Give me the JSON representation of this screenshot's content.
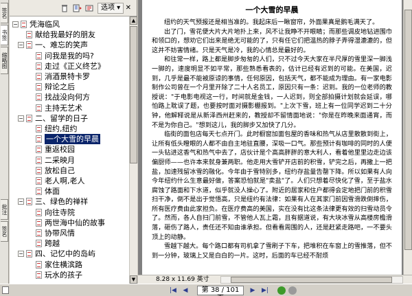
{
  "side_tabs": [
    "签名",
    "书签",
    "缩略图",
    "批注",
    "签名"
  ],
  "panel": {
    "options_label": "选项 ▾",
    "close_label": "✕",
    "bookmarks": [
      {
        "label": "凭海临风",
        "level": 0,
        "expanded": true,
        "selected": false
      },
      {
        "label": "献给我最好的朋友",
        "level": 1,
        "expanded": null,
        "selected": false
      },
      {
        "label": "一、难忘的笑声",
        "level": 1,
        "expanded": true,
        "selected": false
      },
      {
        "label": "问我是我的吗?",
        "level": 2,
        "expanded": null,
        "selected": false
      },
      {
        "label": "走过《正义终艺》",
        "level": 2,
        "expanded": null,
        "selected": false
      },
      {
        "label": "消酒景特卡罗",
        "level": 2,
        "expanded": null,
        "selected": false
      },
      {
        "label": "辩论之后",
        "level": 2,
        "expanded": null,
        "selected": false
      },
      {
        "label": "找战没向何方",
        "level": 2,
        "expanded": null,
        "selected": false
      },
      {
        "label": "主持无艺术",
        "level": 2,
        "expanded": null,
        "selected": false
      },
      {
        "label": "二、留学的日子",
        "level": 1,
        "expanded": true,
        "selected": false
      },
      {
        "label": "纽约,纽约",
        "level": 2,
        "expanded": null,
        "selected": false
      },
      {
        "label": "一个大雪的早晨",
        "level": 2,
        "expanded": null,
        "selected": true
      },
      {
        "label": "重返校园",
        "level": 2,
        "expanded": null,
        "selected": false
      },
      {
        "label": "二采映月",
        "level": 2,
        "expanded": null,
        "selected": false
      },
      {
        "label": "放松自己",
        "level": 2,
        "expanded": null,
        "selected": false
      },
      {
        "label": "老人啊,老人",
        "level": 2,
        "expanded": null,
        "selected": false
      },
      {
        "label": "体面",
        "level": 2,
        "expanded": null,
        "selected": false
      },
      {
        "label": "三、绿色的禅祥",
        "level": 1,
        "expanded": true,
        "selected": false
      },
      {
        "label": "向往寺院",
        "level": 2,
        "expanded": null,
        "selected": false
      },
      {
        "label": "两世海中仙的故事",
        "level": 2,
        "expanded": null,
        "selected": false
      },
      {
        "label": "协带风情",
        "level": 2,
        "expanded": null,
        "selected": false
      },
      {
        "label": "跨越",
        "level": 2,
        "expanded": null,
        "selected": false
      },
      {
        "label": "四、记忆中的岛屿",
        "level": 1,
        "expanded": true,
        "selected": false
      },
      {
        "label": "家住横滨路",
        "level": 2,
        "expanded": null,
        "selected": false
      },
      {
        "label": "玩水的孩子",
        "level": 2,
        "expanded": null,
        "selected": false
      }
    ]
  },
  "document": {
    "title": "一个大雪的早晨",
    "paragraphs": [
      "纽约的天气预报还是相当准的。我起床后一瞅窗帘，外面果真是鹅毛满天了。",
      "出了门，雪花便大片大片地扑上来，风不让我睁不开眼睛；而那些调皮地钻进围巾和领口的，想劝它们出来是绝无可能的了，只有任它们把温热的脖子弄得湿漉漉的，但这并不妨害情绪。只是天气是冷，我的心情总是最好的。",
      "和往常一样，路上都是脚步匆匆的人们，只不过今天大家在半尺厚的雪里深一脚浅一脚的，速度明显不如平常，那些熟悉看表的，估计已经有迟到的可能。在美国，迟到，几乎是最不能被原谅的事情，任何原因，包括天气，都不能成为理由。有一家电影制作公司曾在一个月里开除了二十人名员工，原因只有一条：迟到。我的一位老师的教授说：\"于电影电视这一行，时间就是金钱，一人迟到，则全部拍摄计划就会延误，哪怕路上耽误了题，也要按时面对摄影棚报到。\"上次下雪，班上有一位同学迟到二十分钟，他解释说是从新泽西州赶来的，教授却不留情面地说：\"你是在昨晚来面通宵，而不是为你自己。\"想到这儿，我的脚步又加快了几分。",
      "临街的面包店每天七点开门。此时橱窗加面包屋的香味和热气从店里散散到街上，让所有低头瞪眼的人都不由自主地驻直腰，深吸一口气。那些预计有咖啡的同时的人便一头钻进这香气和热气中去了，店伙计是个高高胖胖的意大利人，看着他里里边走边该偏厨师——也许本来就身兼两职。他走用大雪铲开店前的积雪，铲完之后，再撒上一把盐，加速残留冰雪的融化。今年由于雪特别多，纽约存盐量告罄下降。所以如果有人向今年纽约什么生意最好做，答案恐怕就是\"卖盐\"了。人们只想着尽快化了雪，至于盐水腐蚀了路面和下水道，似乎就没人操心了。附近的居家和住户都得会定地把门前的积雪扫干净，倒不是出于觉悟高，只是纽约有法律：如果有人在其家门前因雪滑跌倒摔伤，所有医疗费由此家担负。在医疗费高的美国，实在没有比这条法律更有效的扫雪动员令了。然而，各人自扫门前雪，不管他人瓦上霜，且有据道说，有大块冰雪从高楼房檐滑落，砸伤了路人，责任还不知由谁承担。但看看周围的人，还是赶紧走路吧，一不要头顶上的动静。",
      "雪越下越大。每个路口都有司机拿了雪刷子下车，把堆积在车窗上的雪推落，但不到一分钟，玻璃上又是白白的一片。这时，后面的车已经不耐烦"
    ],
    "page_size": "8.28 x 11.69 英寸"
  },
  "navbar": {
    "page_field": "第 38 / 101 页",
    "first_label": "|◀",
    "prev_label": "◀",
    "next_label": "▶",
    "last_label": "▶|"
  },
  "colors": {
    "selection": "#0a246a",
    "nav_green": "#3d9a2a",
    "nav_gray": "#9a9a9a",
    "chrome": "#d4d0c8"
  }
}
